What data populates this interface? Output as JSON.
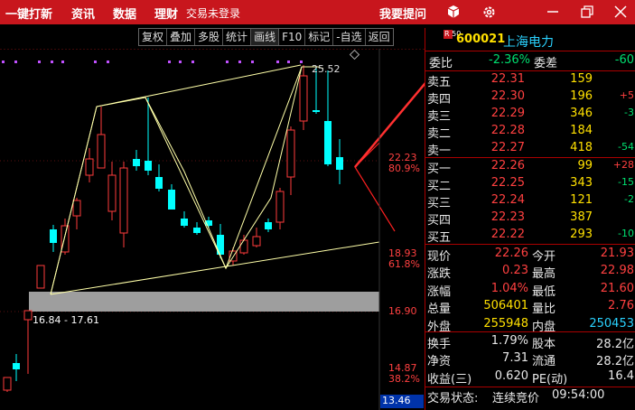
{
  "topbar": {
    "menu": [
      "一键打新",
      "资讯",
      "数据",
      "理财"
    ],
    "status": "交易未登录",
    "ask": "我要提问",
    "icons": [
      "cube-icon",
      "gear-icon",
      "minimize-icon",
      "restore-icon",
      "close-icon"
    ]
  },
  "toolbar": [
    "复权",
    "叠加",
    "多股",
    "统计",
    "画线",
    "F10",
    "标记",
    "-自选",
    "返回"
  ],
  "chart": {
    "peak_label": "25.52",
    "range_label": "16.84 - 17.61",
    "bottom_value": "13.46",
    "right_labels": [
      {
        "price": "22.23",
        "pct": "80.9%"
      },
      {
        "price": "18.93",
        "pct": "61.8%"
      },
      {
        "price": "16.90",
        "pct": ""
      },
      {
        "price": "14.87",
        "pct": "38.2%"
      }
    ],
    "colors": {
      "up": "#ff3b3b",
      "down": "#00ffff",
      "line": "#ffffa0",
      "fib": "#c8c8c8"
    }
  },
  "quote": {
    "badge": "R 50",
    "code": "600021",
    "name": "上海电力",
    "ratio": {
      "l1": "委比",
      "v1": "-2.36%",
      "l2": "委差",
      "v2": "-60"
    },
    "asks": [
      {
        "label": "卖五",
        "price": "22.31",
        "vol": "159",
        "chg": ""
      },
      {
        "label": "卖四",
        "price": "22.30",
        "vol": "196",
        "chg": "+5"
      },
      {
        "label": "卖三",
        "price": "22.29",
        "vol": "346",
        "chg": "-3"
      },
      {
        "label": "卖二",
        "price": "22.28",
        "vol": "184",
        "chg": ""
      },
      {
        "label": "卖一",
        "price": "22.27",
        "vol": "418",
        "chg": "-54"
      }
    ],
    "bids": [
      {
        "label": "买一",
        "price": "22.26",
        "vol": "99",
        "chg": "+28"
      },
      {
        "label": "买二",
        "price": "22.25",
        "vol": "343",
        "chg": "-15"
      },
      {
        "label": "买三",
        "price": "22.24",
        "vol": "121",
        "chg": "-2"
      },
      {
        "label": "买四",
        "price": "22.23",
        "vol": "387",
        "chg": ""
      },
      {
        "label": "买五",
        "price": "22.22",
        "vol": "293",
        "chg": "-10"
      }
    ],
    "stats": [
      {
        "l1": "现价",
        "v1": "22.26",
        "l2": "今开",
        "v2": "21.93"
      },
      {
        "l1": "涨跌",
        "v1": "0.23",
        "l2": "最高",
        "v2": "22.98"
      },
      {
        "l1": "涨幅",
        "v1": "1.04%",
        "l2": "最低",
        "v2": "21.60"
      },
      {
        "l1": "总量",
        "v1": "506401",
        "l2": "量比",
        "v2": "2.76"
      },
      {
        "l1": "外盘",
        "v1": "255948",
        "l2": "内盘",
        "v2": "250453"
      }
    ],
    "stats2": [
      {
        "l1": "换手",
        "v1": "1.79%",
        "l2": "股本",
        "v2": "28.2亿"
      },
      {
        "l1": "净资",
        "v1": "7.31",
        "l2": "流通",
        "v2": "28.2亿"
      },
      {
        "l1": "收益(三)",
        "v1": "0.620",
        "l2": "PE(动)",
        "v2": "16.4"
      }
    ],
    "trade_state": {
      "label": "交易状态:",
      "value": "连续竞价",
      "time": "09:54:00"
    }
  }
}
